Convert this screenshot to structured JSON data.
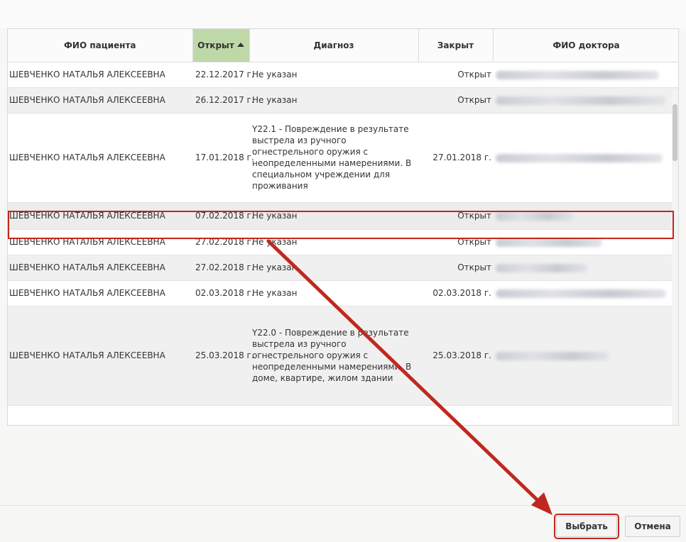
{
  "table": {
    "headers": {
      "patient": "ФИО пациента",
      "opened": "Открыт",
      "diagnosis": "Диагноз",
      "closed": "Закрыт",
      "doctor": "ФИО доктора"
    },
    "sort_icon": "sort-ascending-icon",
    "rows": [
      {
        "patient": "ШЕВЧЕНКО НАТАЛЬЯ АЛЕКСЕЕВНА",
        "opened": "22.12.2017 г.",
        "diagnosis": "Не указан",
        "closed": "Открыт"
      },
      {
        "patient": "ШЕВЧЕНКО НАТАЛЬЯ АЛЕКСЕЕВНА",
        "opened": "26.12.2017 г.",
        "diagnosis": "Не указан",
        "closed": "Открыт"
      },
      {
        "patient": "ШЕВЧЕНКО НАТАЛЬЯ АЛЕКСЕЕВНА",
        "opened": "17.01.2018 г.",
        "diagnosis": "Y22.1 - Повреждение в результате выстрела из ручного огнестрельного оружия с неопределенными намерениями. В специальном учреждении для проживания",
        "closed": "27.01.2018 г."
      },
      {
        "patient": "ШЕВЧЕНКО НАТАЛЬЯ АЛЕКСЕЕВНА",
        "opened": "07.02.2018 г.",
        "diagnosis": "Не указан",
        "closed": "Открыт"
      },
      {
        "patient": "ШЕВЧЕНКО НАТАЛЬЯ АЛЕКСЕЕВНА",
        "opened": "27.02.2018 г.",
        "diagnosis": "Не указан",
        "closed": "Открыт"
      },
      {
        "patient": "ШЕВЧЕНКО НАТАЛЬЯ АЛЕКСЕЕВНА",
        "opened": "27.02.2018 г.",
        "diagnosis": "Не указан",
        "closed": "Открыт"
      },
      {
        "patient": "ШЕВЧЕНКО НАТАЛЬЯ АЛЕКСЕЕВНА",
        "opened": "02.03.2018 г.",
        "diagnosis": "Не указан",
        "closed": "02.03.2018 г."
      },
      {
        "patient": "ШЕВЧЕНКО НАТАЛЬЯ АЛЕКСЕЕВНА",
        "opened": "25.03.2018 г.",
        "diagnosis": "Y22.0 - Повреждение в результате выстрела из ручного огнестрельного оружия с неопределенными намерениями. В доме, квартире, жилом здании",
        "closed": "25.03.2018 г."
      }
    ]
  },
  "buttons": {
    "select": "Выбрать",
    "cancel": "Отмена"
  },
  "colors": {
    "highlight": "#c0281f",
    "sorted_header": "#bfd8a8"
  }
}
